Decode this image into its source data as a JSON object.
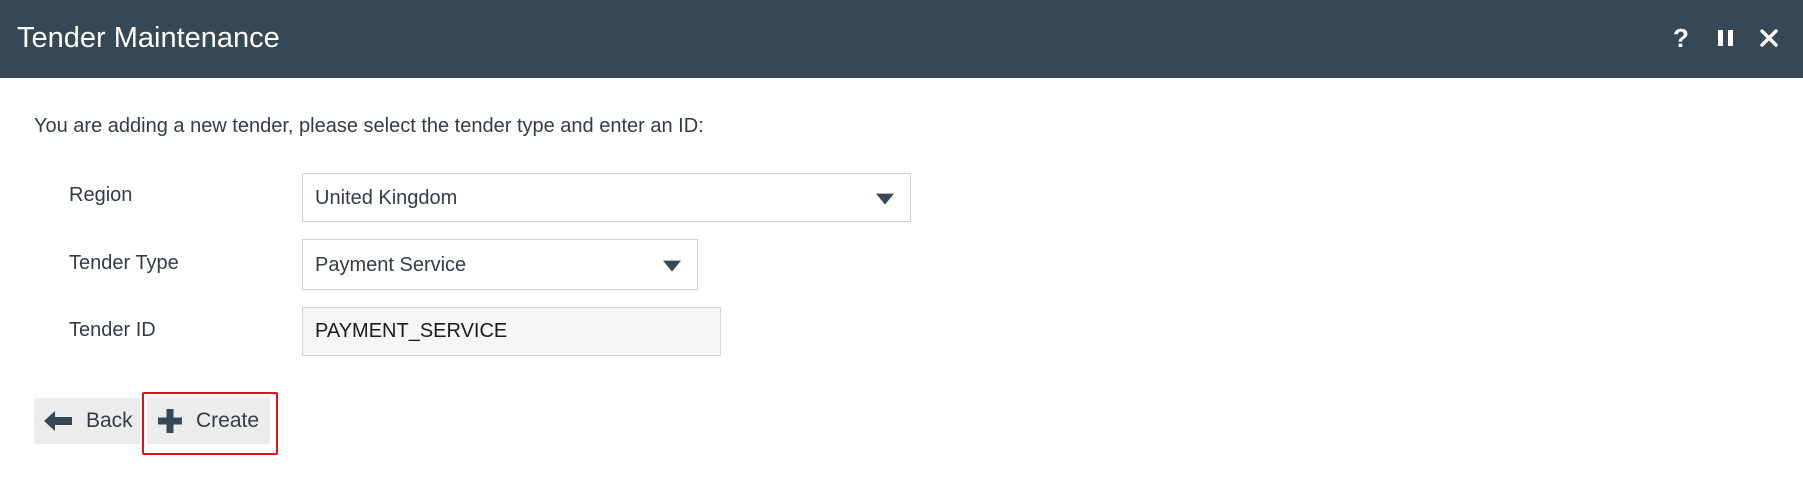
{
  "header": {
    "title": "Tender Maintenance",
    "help_icon": "question-mark-icon",
    "pause_icon": "pause-icon",
    "close_icon": "close-icon"
  },
  "form": {
    "intro": "You are adding a new tender, please select the tender type and enter an ID:",
    "region": {
      "label": "Region",
      "value": "United Kingdom"
    },
    "tender_type": {
      "label": "Tender Type",
      "value": "Payment Service"
    },
    "tender_id": {
      "label": "Tender ID",
      "value": "PAYMENT_SERVICE"
    }
  },
  "buttons": {
    "back": {
      "label": "Back",
      "icon": "arrow-left-icon"
    },
    "create": {
      "label": "Create",
      "icon": "plus-icon"
    }
  },
  "colors": {
    "header_bg": "#364855",
    "text": "#333c45",
    "button_bg": "#ececec",
    "highlight": "#e0101e"
  }
}
